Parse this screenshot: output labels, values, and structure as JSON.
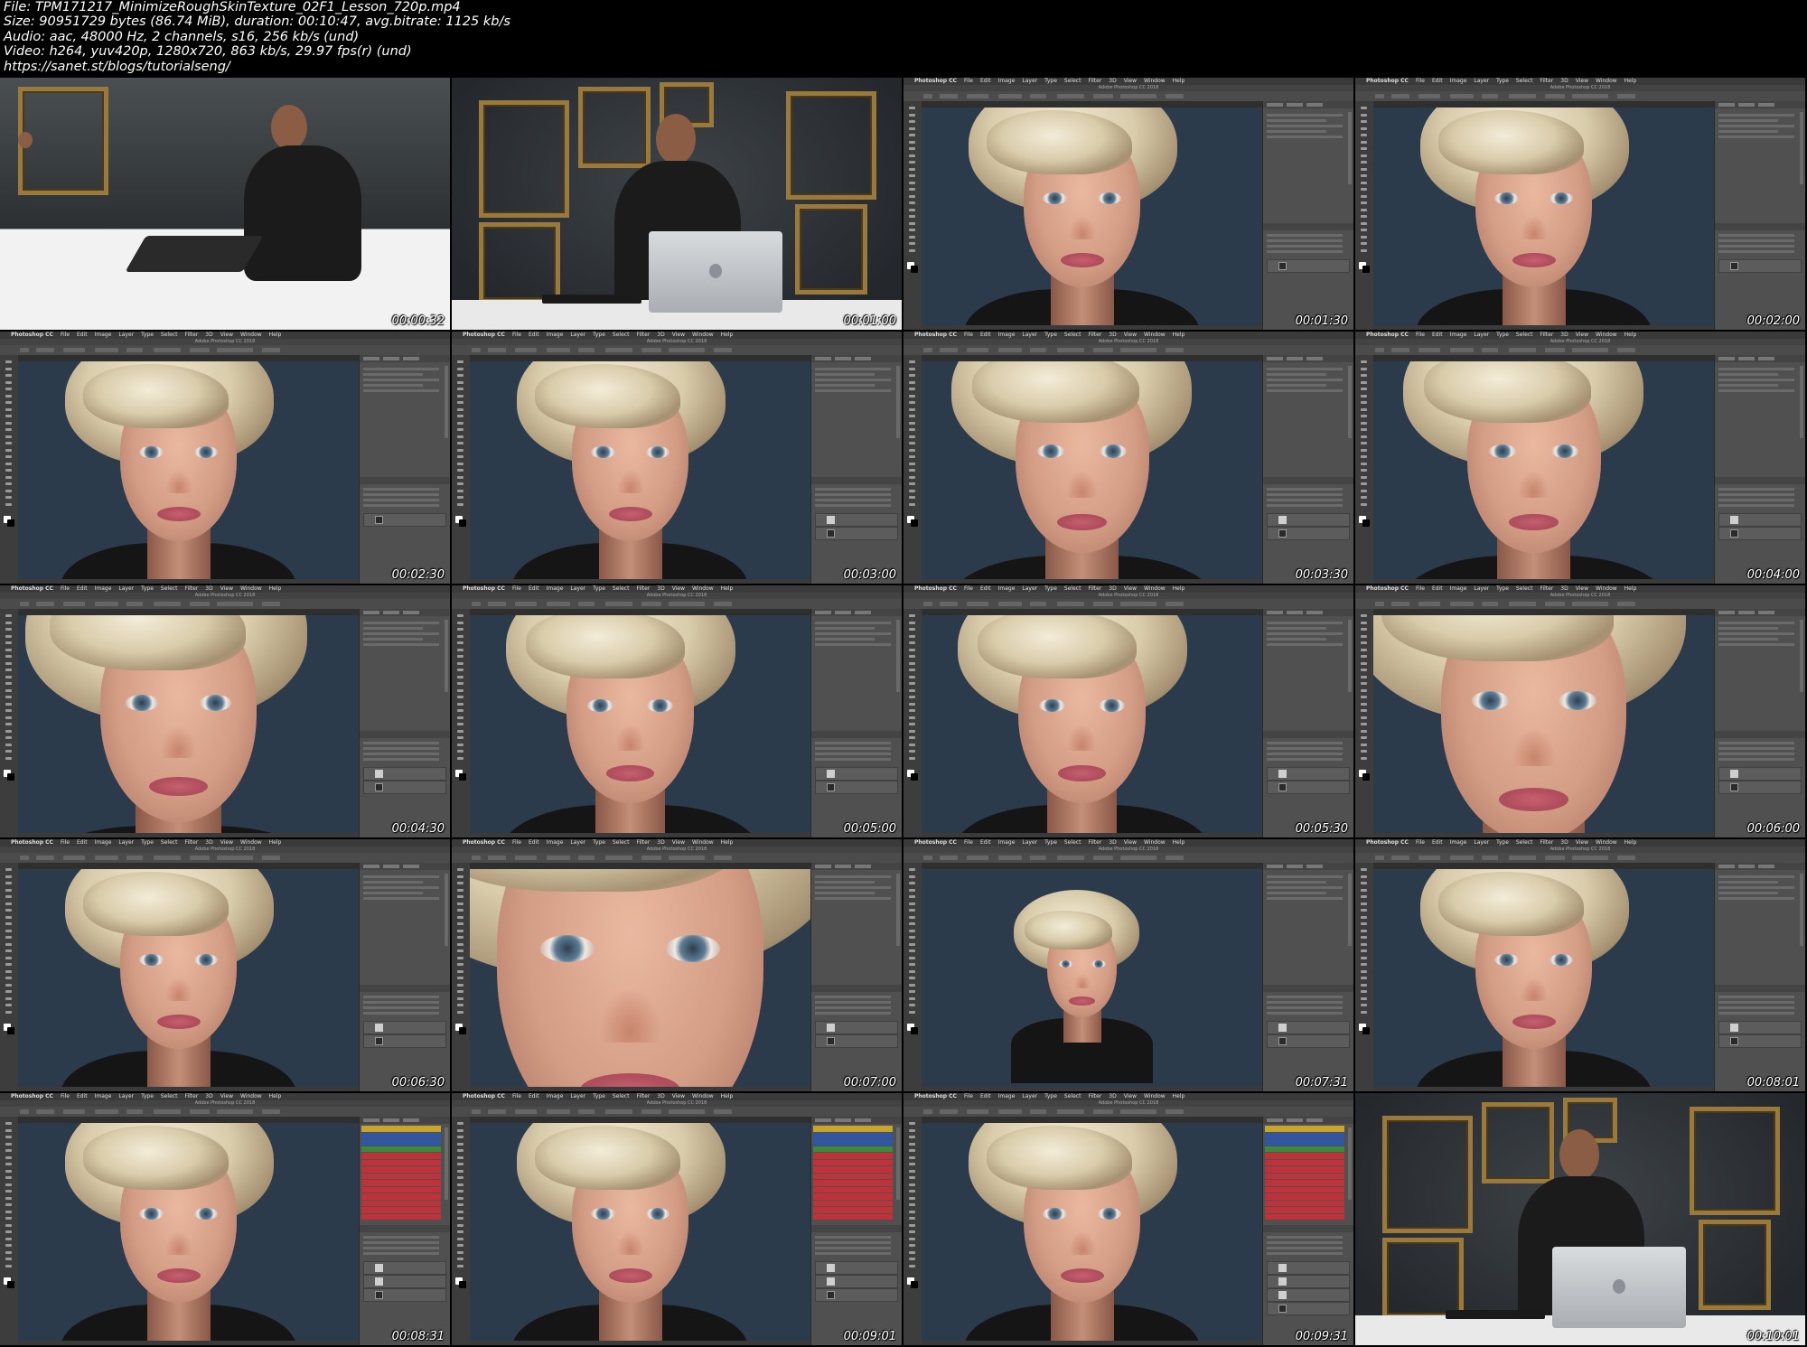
{
  "file_info": {
    "file": "File: TPM171217_MinimizeRoughSkinTexture_02F1_Lesson_720p.mp4",
    "size": "Size: 90951729 bytes (86.74 MiB), duration: 00:10:47, avg.bitrate: 1125 kb/s",
    "audio": "Audio: aac, 48000 Hz, 2 channels, s16, 256 kb/s (und)",
    "video": "Video: h264, yuv420p, 1280x720, 863 kb/s, 29.97 fps(r) (und)",
    "url": "https://sanet.st/blogs/tutorialseng/"
  },
  "photoshop": {
    "app": "Photoshop CC",
    "menu": [
      "File",
      "Edit",
      "Image",
      "Layer",
      "Type",
      "Select",
      "Filter",
      "3D",
      "View",
      "Window",
      "Help"
    ],
    "app_title": "Adobe Photoshop CC 2018"
  },
  "colors": {
    "background": "#000000",
    "ps_panel": "#505050",
    "backdrop": "#2b3b4c",
    "action_red": "#c0323a",
    "action_blue": "#2f55a6",
    "action_yellow": "#c8a52a",
    "action_green": "#3f8a3a",
    "frame_gold": "#9a7a3c"
  },
  "thumbnails": [
    {
      "time": "00:00:32",
      "kind": "studio-side"
    },
    {
      "time": "00:01:00",
      "kind": "studio-front"
    },
    {
      "time": "00:01:30",
      "kind": "ps",
      "zoom": 1.0,
      "layers": 1,
      "panel": "props"
    },
    {
      "time": "00:02:00",
      "kind": "ps",
      "zoom": 1.0,
      "layers": 1,
      "panel": "props"
    },
    {
      "time": "00:02:30",
      "kind": "ps",
      "zoom": 1.0,
      "layers": 1,
      "panel": "props"
    },
    {
      "time": "00:03:00",
      "kind": "ps",
      "zoom": 1.0,
      "layers": 2,
      "panel": "props"
    },
    {
      "time": "00:03:30",
      "kind": "ps",
      "zoom": 1.15,
      "layers": 2,
      "panel": "props"
    },
    {
      "time": "00:04:00",
      "kind": "ps",
      "zoom": 1.15,
      "layers": 2,
      "panel": "props"
    },
    {
      "time": "00:04:30",
      "kind": "ps",
      "zoom": 1.35,
      "layers": 2,
      "panel": "props"
    },
    {
      "time": "00:05:00",
      "kind": "ps",
      "zoom": 1.1,
      "layers": 2,
      "panel": "props"
    },
    {
      "time": "00:05:30",
      "kind": "ps",
      "zoom": 1.1,
      "layers": 2,
      "panel": "props"
    },
    {
      "time": "00:06:00",
      "kind": "ps",
      "zoom": 1.6,
      "layers": 2,
      "panel": "props"
    },
    {
      "time": "00:06:30",
      "kind": "ps",
      "zoom": 1.0,
      "layers": 2,
      "panel": "props"
    },
    {
      "time": "00:07:00",
      "kind": "ps",
      "zoom": 2.3,
      "layers": 2,
      "panel": "props"
    },
    {
      "time": "00:07:31",
      "kind": "ps",
      "zoom": 0.6,
      "layers": 2,
      "panel": "props"
    },
    {
      "time": "00:08:01",
      "kind": "ps",
      "zoom": 1.0,
      "layers": 2,
      "panel": "props"
    },
    {
      "time": "00:08:31",
      "kind": "ps",
      "zoom": 1.0,
      "layers": 3,
      "panel": "actions"
    },
    {
      "time": "00:09:01",
      "kind": "ps",
      "zoom": 1.0,
      "layers": 3,
      "panel": "actions"
    },
    {
      "time": "00:09:31",
      "kind": "ps",
      "zoom": 1.0,
      "layers": 4,
      "panel": "actions"
    },
    {
      "time": "00:10:01",
      "kind": "studio-front"
    }
  ]
}
